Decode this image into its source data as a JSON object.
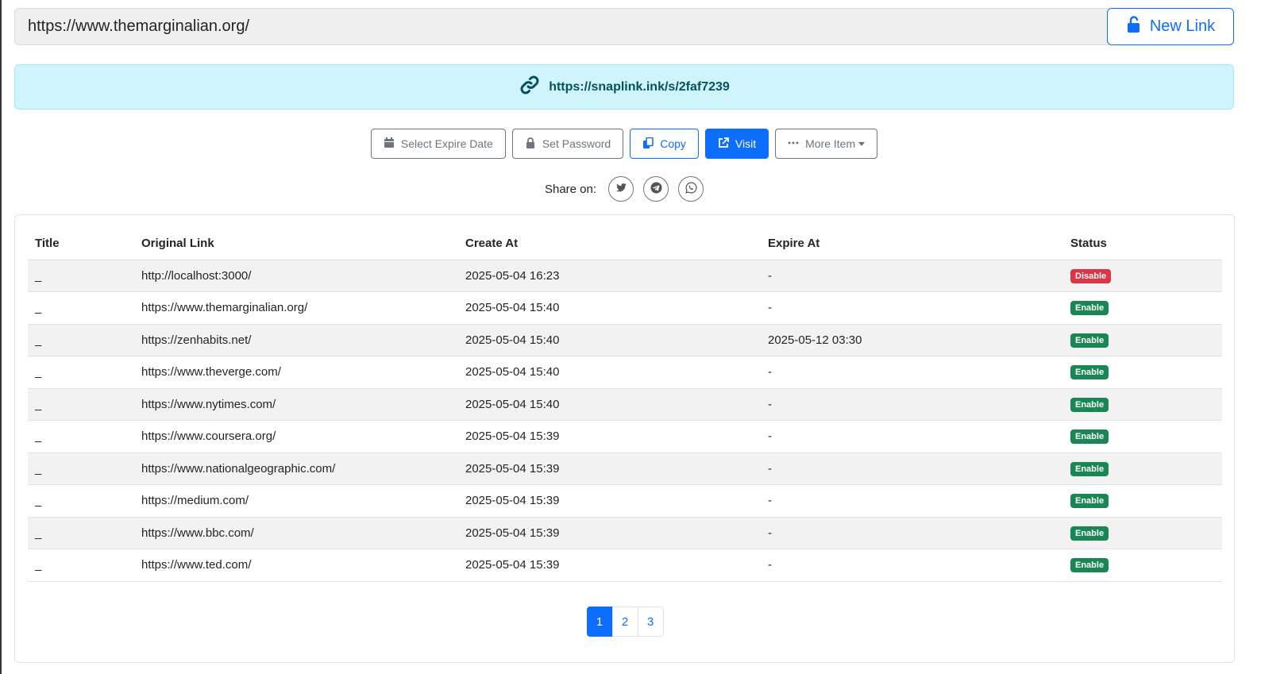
{
  "url_input": {
    "value": "https://www.themarginalian.org/"
  },
  "new_link_button": {
    "label": "New Link",
    "icon": "unlock-icon"
  },
  "short_link": {
    "url": "https://snaplink.ink/s/2faf7239",
    "icon": "link-icon"
  },
  "actions": {
    "expire_label": "Select Expire Date",
    "password_label": "Set Password",
    "copy_label": "Copy",
    "visit_label": "Visit",
    "more_label": "More Item"
  },
  "share": {
    "label": "Share on:",
    "targets": [
      "twitter",
      "telegram",
      "whatsapp"
    ]
  },
  "table": {
    "headers": {
      "title": "Title",
      "link": "Original Link",
      "create": "Create At",
      "expire": "Expire At",
      "status": "Status"
    },
    "rows": [
      {
        "title": "_",
        "link": "http://localhost:3000/",
        "create": "2025-05-04 16:23",
        "expire": "-",
        "status": "Disable"
      },
      {
        "title": "_",
        "link": "https://www.themarginalian.org/",
        "create": "2025-05-04 15:40",
        "expire": "-",
        "status": "Enable"
      },
      {
        "title": "_",
        "link": "https://zenhabits.net/",
        "create": "2025-05-04 15:40",
        "expire": "2025-05-12 03:30",
        "status": "Enable"
      },
      {
        "title": "_",
        "link": "https://www.theverge.com/",
        "create": "2025-05-04 15:40",
        "expire": "-",
        "status": "Enable"
      },
      {
        "title": "_",
        "link": "https://www.nytimes.com/",
        "create": "2025-05-04 15:40",
        "expire": "-",
        "status": "Enable"
      },
      {
        "title": "_",
        "link": "https://www.coursera.org/",
        "create": "2025-05-04 15:39",
        "expire": "-",
        "status": "Enable"
      },
      {
        "title": "_",
        "link": "https://www.nationalgeographic.com/",
        "create": "2025-05-04 15:39",
        "expire": "-",
        "status": "Enable"
      },
      {
        "title": "_",
        "link": "https://medium.com/",
        "create": "2025-05-04 15:39",
        "expire": "-",
        "status": "Enable"
      },
      {
        "title": "_",
        "link": "https://www.bbc.com/",
        "create": "2025-05-04 15:39",
        "expire": "-",
        "status": "Enable"
      },
      {
        "title": "_",
        "link": "https://www.ted.com/",
        "create": "2025-05-04 15:39",
        "expire": "-",
        "status": "Enable"
      }
    ]
  },
  "pagination": {
    "pages": [
      "1",
      "2",
      "3"
    ],
    "active": "1"
  },
  "colors": {
    "primary": "#0d6efd",
    "enable": "#198754",
    "disable": "#dc3545",
    "alert_bg": "#cff4fc",
    "alert_text": "#055160"
  }
}
